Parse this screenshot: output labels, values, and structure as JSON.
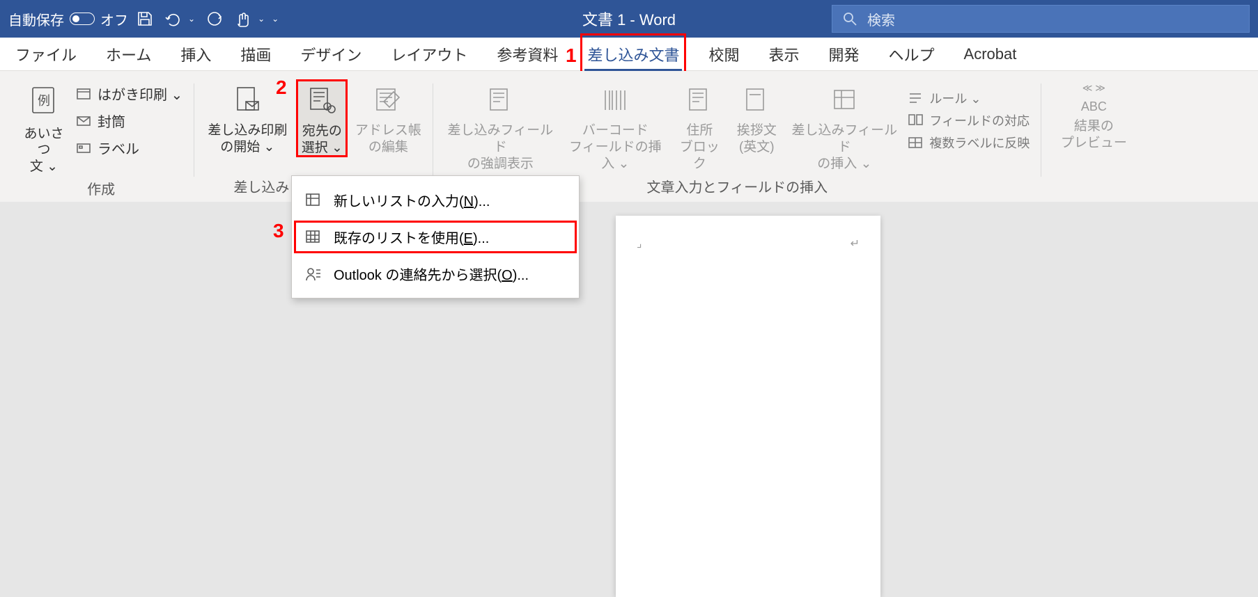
{
  "titlebar": {
    "autosave_label": "自動保存",
    "autosave_state": "オフ",
    "document_title": "文書 1  -  Word",
    "search_placeholder": "検索"
  },
  "tabs": {
    "file": "ファイル",
    "home": "ホーム",
    "insert": "挿入",
    "draw": "描画",
    "design": "デザイン",
    "layout": "レイアウト",
    "references": "参考資料",
    "mailings": "差し込み文書",
    "review": "校閲",
    "view": "表示",
    "developer": "開発",
    "help": "ヘルプ",
    "acrobat": "Acrobat"
  },
  "ribbon": {
    "group_create": {
      "greeting": "あいさつ\n文 ⌄",
      "greeting_example": "例",
      "postcard": "はがき印刷 ⌄",
      "envelope": "封筒",
      "label": "ラベル",
      "title": "作成"
    },
    "group_start": {
      "start_merge": "差し込み印刷\nの開始 ⌄",
      "select_recipients": "宛先の\n選択 ⌄",
      "edit_address": "アドレス帳\nの編集",
      "title": "差し込み"
    },
    "group_fields": {
      "highlight": "差し込みフィールド\nの強調表示",
      "barcode": "バーコード\nフィールドの挿入 ⌄",
      "address_block": "住所\nブロック",
      "greeting_line": "挨拶文\n(英文)",
      "insert_field": "差し込みフィールド\nの挿入 ⌄",
      "rules": "ルール ⌄",
      "match_fields": "フィールドの対応",
      "update_labels": "複数ラベルに反映",
      "title": "文章入力とフィールドの挿入"
    },
    "group_preview": {
      "arrows": "≪ ≫",
      "abc": "ABC",
      "label": "結果の\nプレビュー"
    }
  },
  "dropdown": {
    "new_list": "新しいリストの入力(N)...",
    "use_existing": "既存のリストを使用(E)...",
    "outlook": "Outlook の連絡先から選択(O)..."
  },
  "annotations": {
    "a1": "1",
    "a2": "2",
    "a3": "3"
  }
}
